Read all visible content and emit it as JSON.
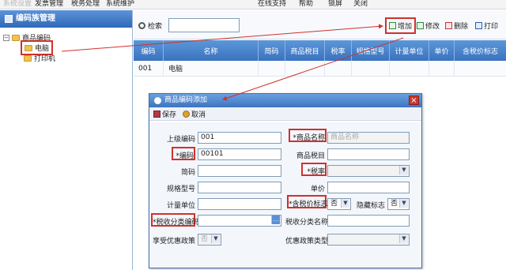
{
  "menubar": {
    "items": [
      "系统设置",
      "发票管理",
      "税务处理",
      "系统维护",
      "在线支持",
      "帮助",
      "锁屏",
      "关闭"
    ]
  },
  "left_panel": {
    "title": "编码族管理",
    "tree": [
      {
        "label": "商品编码"
      },
      {
        "label": "电脑"
      },
      {
        "label": "打印机"
      }
    ]
  },
  "toolbar": {
    "search_label": "检索",
    "search_value": "",
    "buttons": [
      "增加",
      "修改",
      "删除",
      "打印"
    ]
  },
  "grid": {
    "columns": [
      "编码",
      "名称",
      "简码",
      "商品税目",
      "税率",
      "规格型号",
      "计量单位",
      "单价",
      "含税价标志"
    ],
    "rows": [
      [
        "001",
        "电脑",
        "",
        "",
        "",
        "",
        "",
        "",
        ""
      ]
    ]
  },
  "dialog": {
    "title": "商品编码添加",
    "close_glyph": "×",
    "toolbar": {
      "save": "保存",
      "cancel": "取消"
    },
    "fields": {
      "parent_code": {
        "label": "上级编码",
        "value": "001"
      },
      "product_name": {
        "label": "*商品名称",
        "value": "",
        "placeholder": "商品名称"
      },
      "code": {
        "label": "*编码",
        "value": "00101"
      },
      "tax_item": {
        "label": "商品税目",
        "value": ""
      },
      "short_code": {
        "label": "简码",
        "value": ""
      },
      "tax_rate": {
        "label": "*税率",
        "value": ""
      },
      "spec_model": {
        "label": "规格型号",
        "value": ""
      },
      "unit_price": {
        "label": "单价",
        "value": ""
      },
      "unit": {
        "label": "计量单位",
        "value": ""
      },
      "tax_included": {
        "label": "*含税价标志",
        "value": "否"
      },
      "hidden_flag": {
        "label": "隐藏标志",
        "value": "否"
      },
      "tax_class_code": {
        "label": "*税收分类编码",
        "value": ""
      },
      "tax_class_name": {
        "label": "税收分类名称",
        "value": ""
      },
      "preferential": {
        "label": "享受优惠政策",
        "value": "否"
      },
      "policy_type": {
        "label": "优惠政策类型",
        "value": ""
      }
    }
  },
  "colors": {
    "header_blue": "#3a72bf",
    "highlight_red": "#d0312d"
  }
}
